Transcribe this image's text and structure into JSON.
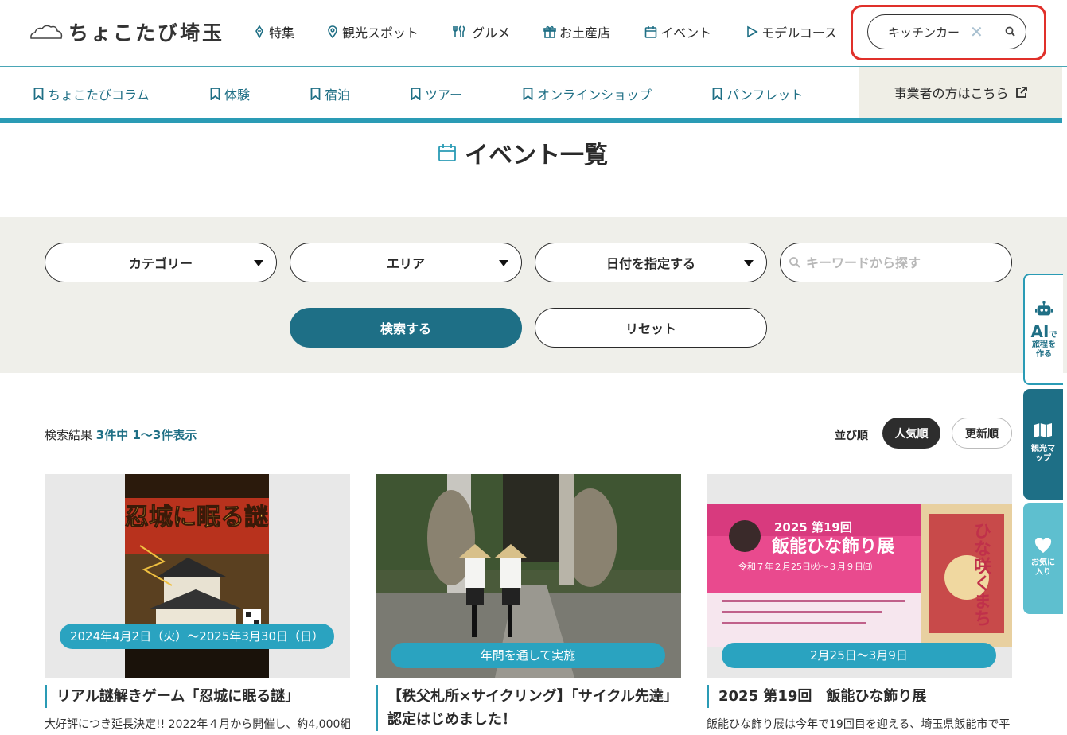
{
  "header": {
    "logo_text": "ちょこたび埼玉",
    "nav": [
      {
        "label": "特集",
        "icon": "pen-icon"
      },
      {
        "label": "観光スポット",
        "icon": "map-pin-icon"
      },
      {
        "label": "グルメ",
        "icon": "cutlery-icon"
      },
      {
        "label": "お土産店",
        "icon": "gift-icon"
      },
      {
        "label": "イベント",
        "icon": "calendar-icon"
      },
      {
        "label": "モデルコース",
        "icon": "play-icon"
      }
    ],
    "search": {
      "value": "キッチンカー"
    }
  },
  "subnav": {
    "items": [
      "ちょこたびコラム",
      "体験",
      "宿泊",
      "ツアー",
      "オンラインショップ",
      "パンフレット"
    ],
    "business_link": "事業者の方はこちら"
  },
  "page_title": "イベント一覧",
  "filters": {
    "category": "カテゴリー",
    "area": "エリア",
    "date": "日付を指定する",
    "keyword_placeholder": "キーワードから探す",
    "search_button": "検索する",
    "reset_button": "リセット"
  },
  "results": {
    "prefix": "検索結果",
    "count_text": "3件中 1〜3件表示",
    "sort_label": "並び順",
    "sort_popular": "人気順",
    "sort_new": "更新順"
  },
  "cards": [
    {
      "date": "2024年4月2日（火）〜2025年3月30日（日）",
      "title": "リアル謎解きゲーム「忍城に眠る謎」",
      "desc": "大好評につき延長決定!! 2022年４月から開催し、約4,000組",
      "poster_text": "忍城に眠る謎"
    },
    {
      "date": "年間を通して実施",
      "title": "【秩父札所×サイクリング】「サイクル先達」認定はじめました！",
      "desc": ""
    },
    {
      "date": "2月25日〜3月9日",
      "title": "2025 第19回　飯能ひな飾り展",
      "desc": "飯能ひな飾り展は今年で19回目を迎える、埼玉県飯能市で平",
      "poster_title": "飯能ひな飾り展",
      "poster_edition": "2025 第19回",
      "poster_dates": "令和７年２月25日㈫〜３月９日㈰",
      "poster_side": "ひな咲くまち"
    }
  ],
  "side_tabs": {
    "ai_big": "AI",
    "ai_small": "で",
    "ai_rest": "旅程を作る",
    "map": "観光マップ",
    "fav": "お気に入り"
  },
  "colors": {
    "accent": "#2a9bb5",
    "dark_accent": "#1e6f86",
    "highlight_border": "#e0302a"
  }
}
